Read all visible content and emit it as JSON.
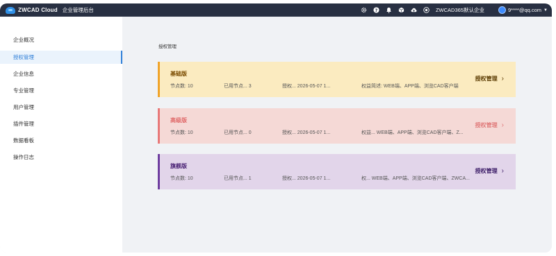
{
  "topbar": {
    "brand": "ZWCAD Cloud",
    "subtitle": "企业管理后台",
    "enterprise": "ZWCAD365默认企业",
    "user_email": "9****@qq.com",
    "icons": [
      "gear-icon",
      "help-icon",
      "bell-icon",
      "package-icon",
      "cloud-icon",
      "enterprise-icon"
    ]
  },
  "sidebar": {
    "items": [
      {
        "label": "企业概况"
      },
      {
        "label": "授权管理",
        "active": true
      },
      {
        "label": "企业信息"
      },
      {
        "label": "专业管理"
      },
      {
        "label": "用户管理"
      },
      {
        "label": "插件管理"
      },
      {
        "label": "数据看板"
      },
      {
        "label": "操作日志"
      }
    ]
  },
  "main": {
    "breadcrumb": "授权管理",
    "cards": [
      {
        "title": "基础版",
        "nodes": "节点数:  10",
        "used": "已用节点...   3",
        "auth": "授权...   2026-05-07 1...",
        "rights": "权益简述:   WEB端、APP端、浏览CAD客户端",
        "manage": "授权管理",
        "color": "#f0a42a"
      },
      {
        "title": "高级版",
        "nodes": "节点数:  10",
        "used": "已用节点...   0",
        "auth": "授权...   2026-05-07 1...",
        "rights": "权益...   WEB端、APP端、浏览CAD客户端、Z...",
        "manage": "授权管理",
        "color": "#e87979"
      },
      {
        "title": "旗舰版",
        "nodes": "节点数:  10",
        "used": "已用节点...   1",
        "auth": "授权...   2026-05-07 1...",
        "rights": "权...  WEB端、APP端、浏览CAD客户端、ZWCA...",
        "manage": "授权管理",
        "color": "#6f3ea0"
      }
    ]
  }
}
